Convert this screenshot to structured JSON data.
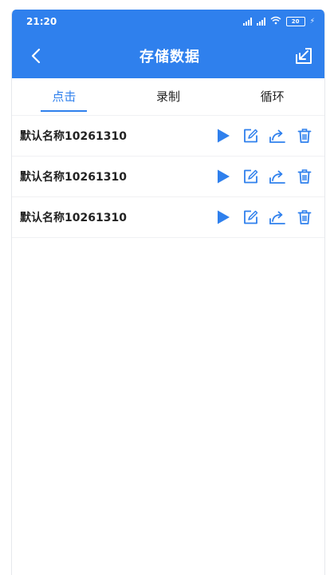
{
  "status": {
    "time": "21:20",
    "battery": "20"
  },
  "appbar": {
    "title": "存储数据"
  },
  "tabs": [
    {
      "label": "点击",
      "active": true
    },
    {
      "label": "录制",
      "active": false
    },
    {
      "label": "循环",
      "active": false
    }
  ],
  "items": [
    {
      "name": "默认名称10261310"
    },
    {
      "name": "默认名称10261310"
    },
    {
      "name": "默认名称10261310"
    }
  ],
  "colors": {
    "accent": "#2f80ed",
    "background": "#ffffff",
    "text": "#222222"
  },
  "icons": {
    "play": "play-icon",
    "edit": "edit-icon",
    "share": "share-icon",
    "delete": "delete-icon",
    "back": "back-icon",
    "import": "import-icon"
  }
}
